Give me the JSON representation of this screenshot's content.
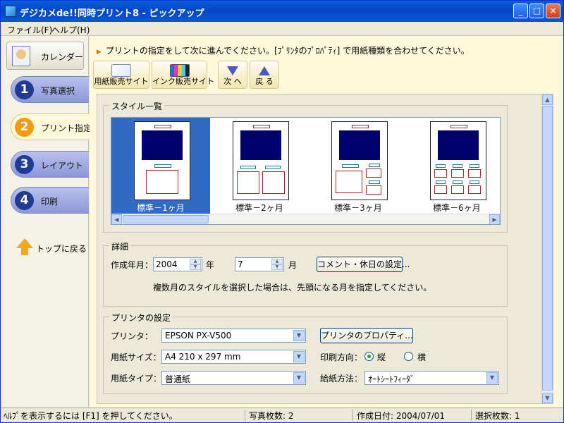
{
  "window": {
    "title": "デジカメde!!同時プリント8 - ピックアップ",
    "controls": [
      "_",
      "□",
      "×"
    ]
  },
  "menu": [
    "ファイル(F)",
    "ヘルプ(H)"
  ],
  "sidebar": {
    "calendar_label": "カレンダー",
    "steps": [
      {
        "num": "1",
        "label": "写真選択"
      },
      {
        "num": "2",
        "label": "プリント指定"
      },
      {
        "num": "3",
        "label": "レイアウト"
      },
      {
        "num": "4",
        "label": "印刷"
      }
    ],
    "top_label": "トップに戻る"
  },
  "main": {
    "instruction": "プリントの指定をして次に進んでください。[ﾌﾟﾘﾝﾀのﾌﾟﾛﾊﾟﾃｨ] で用紙種類を合わせてください。",
    "toolbar": {
      "paper_shop": "用紙販売サイト",
      "ink_shop": "インク販売サイト",
      "next": "次 へ",
      "back": "戻 る"
    }
  },
  "styles": {
    "title": "スタイル一覧",
    "items": [
      "標準－1ヶ月",
      "標準－2ヶ月",
      "標準－3ヶ月",
      "標準－6ヶ月"
    ],
    "selected_index": 0
  },
  "details": {
    "title": "詳細",
    "created_label": "作成年月：",
    "year_value": "2004",
    "year_unit": "年",
    "month_value": "7",
    "month_unit": "月",
    "comment_button": "コメント・休日の設定...",
    "note": "複数月のスタイルを選択した場合は、先頭になる月を指定してください。"
  },
  "printer": {
    "title": "プリンタの設定",
    "printer_label": "プリンタ：",
    "printer_value": "EPSON PX-V500",
    "properties_button": "プリンタのプロパティ...",
    "paper_size_label": "用紙サイズ：",
    "paper_size_value": "A4 210 x 297 mm",
    "orientation_label": "印刷方向：",
    "portrait": "縦",
    "landscape": "横",
    "paper_type_label": "用紙タイプ：",
    "paper_type_value": "普通紙",
    "feed_label": "給紙方法：",
    "feed_value": "ｵｰﾄｼｰﾄﾌｨｰﾀﾞ"
  },
  "status": {
    "help": "ﾍﾙﾌﾟを表示するには [F1] を押してください。",
    "photo_count": "写真枚数: 2",
    "created_date": "作成日付: 2004/07/01",
    "selected_count": "選択枚数: 1"
  },
  "colors": {
    "title_bar": "#0a5fd8",
    "accent_orange": "#f39c12",
    "selection_blue": "#316ac5",
    "panel_bg": "#ece9d8"
  }
}
